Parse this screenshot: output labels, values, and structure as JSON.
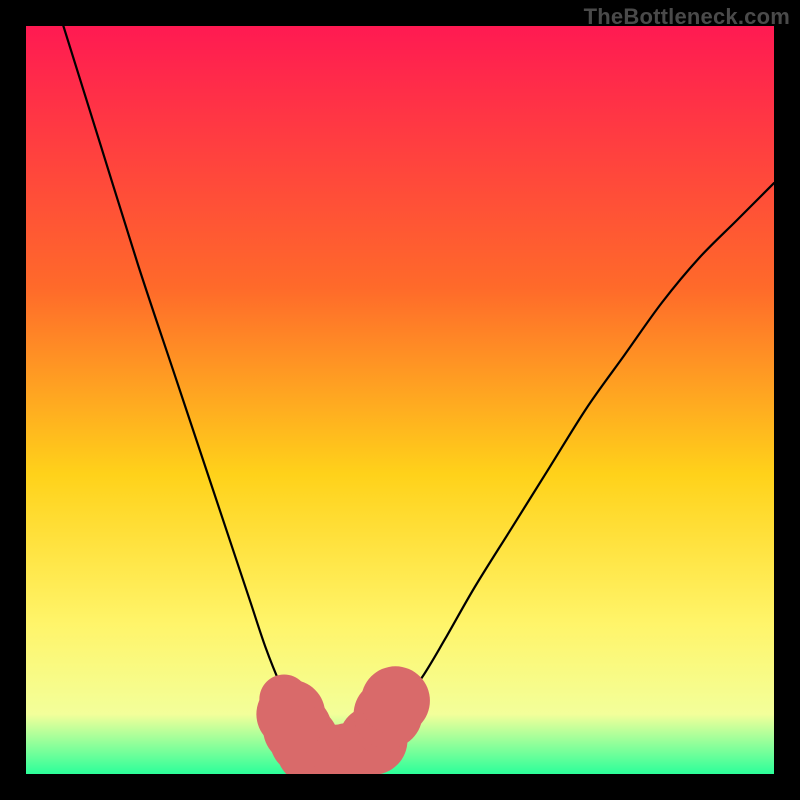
{
  "watermark": "TheBottleneck.com",
  "colors": {
    "frame": "#000000",
    "gradient_top": "#ff1a52",
    "gradient_mid1": "#ff6a2a",
    "gradient_mid2": "#ffd21a",
    "gradient_mid3": "#fff56a",
    "gradient_mid4": "#f3ff9a",
    "gradient_bottom": "#2cff9a",
    "curve": "#000000",
    "marker_fill": "#d96a6a",
    "marker_stroke": "#b94a4a"
  },
  "chart_data": {
    "type": "line",
    "title": "",
    "xlabel": "",
    "ylabel": "",
    "xlim": [
      0,
      100
    ],
    "ylim": [
      0,
      100
    ],
    "series": [
      {
        "name": "bottleneck-curve",
        "x": [
          5,
          10,
          15,
          20,
          25,
          28,
          30,
          32,
          34,
          36,
          37,
          38,
          39,
          40,
          41,
          42,
          43,
          44,
          45,
          46,
          48,
          50,
          53,
          56,
          60,
          65,
          70,
          75,
          80,
          85,
          90,
          95,
          100
        ],
        "y": [
          100,
          84,
          68,
          53,
          38,
          29,
          23,
          17,
          12,
          8,
          6,
          4,
          3,
          2,
          2,
          2,
          2,
          2,
          3,
          4,
          6,
          9,
          13,
          18,
          25,
          33,
          41,
          49,
          56,
          63,
          69,
          74,
          79
        ]
      }
    ],
    "markers": {
      "name": "optimal-range-markers",
      "points": [
        {
          "x": 34.5,
          "y": 10,
          "r": 3.3
        },
        {
          "x": 35.4,
          "y": 8,
          "r": 4.6
        },
        {
          "x": 36.3,
          "y": 6,
          "r": 4.6
        },
        {
          "x": 37.2,
          "y": 4.5,
          "r": 4.6
        },
        {
          "x": 38.1,
          "y": 3.2,
          "r": 4.6
        },
        {
          "x": 39.0,
          "y": 2.4,
          "r": 4.6
        },
        {
          "x": 40.0,
          "y": 2.0,
          "r": 4.6
        },
        {
          "x": 41.0,
          "y": 2.0,
          "r": 4.6
        },
        {
          "x": 42.0,
          "y": 2.0,
          "r": 4.6
        },
        {
          "x": 43.0,
          "y": 2.2,
          "r": 4.6
        },
        {
          "x": 45.2,
          "y": 3.2,
          "r": 3.3
        },
        {
          "x": 46.4,
          "y": 4.5,
          "r": 4.6
        },
        {
          "x": 47.3,
          "y": 6.0,
          "r": 3.3
        },
        {
          "x": 48.4,
          "y": 8.0,
          "r": 4.6
        },
        {
          "x": 49.4,
          "y": 9.8,
          "r": 4.6
        }
      ]
    }
  }
}
